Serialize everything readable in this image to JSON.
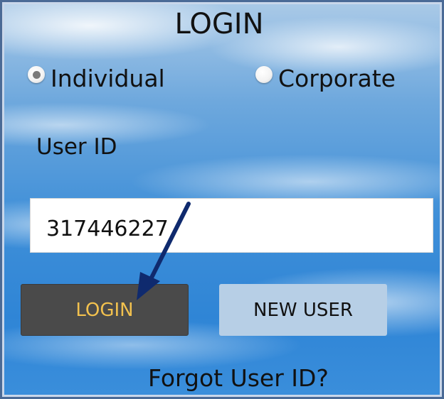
{
  "header": {
    "title": "LOGIN"
  },
  "account_type": {
    "options": [
      {
        "label": "Individual",
        "selected": true
      },
      {
        "label": "Corporate",
        "selected": false
      }
    ]
  },
  "form": {
    "userid_label": "User ID",
    "userid_value": "317446227"
  },
  "buttons": {
    "login_label": "LOGIN",
    "new_user_label": "NEW USER"
  },
  "links": {
    "forgot_user_id": "Forgot User ID?"
  },
  "colors": {
    "login_button_bg": "#4a4a4a",
    "login_button_text": "#f2c14e",
    "new_user_button_bg": "#b7cfe6",
    "annotation_arrow": "#0f2a6e"
  }
}
